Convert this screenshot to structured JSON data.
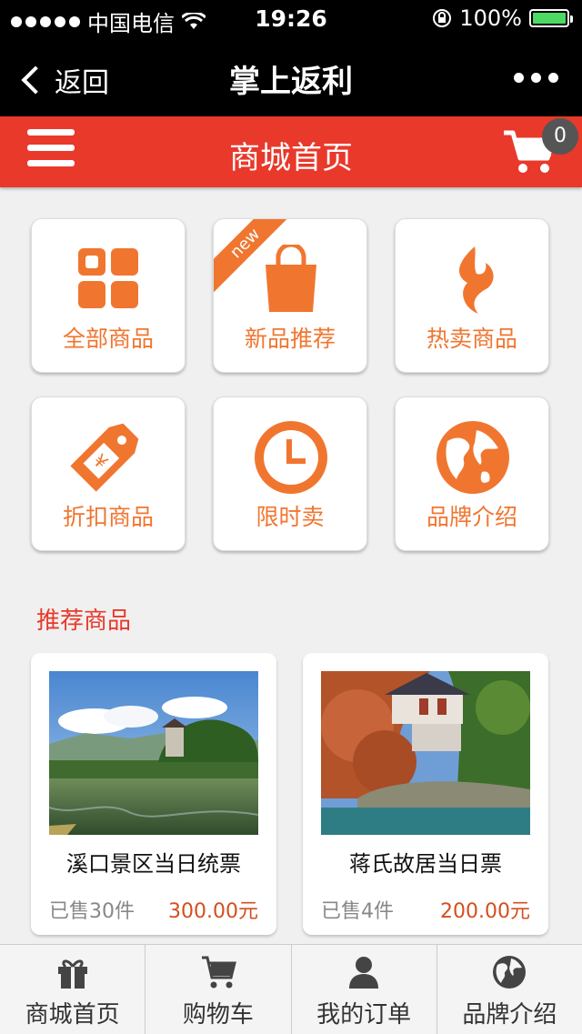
{
  "status_bar": {
    "carrier": "中国电信",
    "time": "19:26",
    "battery": "100%"
  },
  "nav": {
    "back_label": "返回",
    "title": "掌上返利"
  },
  "header": {
    "title": "商城首页",
    "cart_count": "0"
  },
  "grid": {
    "items": [
      {
        "label": "全部商品",
        "icon": "grid-icon"
      },
      {
        "label": "新品推荐",
        "icon": "shopping-bag-icon",
        "ribbon": "new"
      },
      {
        "label": "热卖商品",
        "icon": "flame-icon"
      },
      {
        "label": "折扣商品",
        "icon": "price-tag-icon"
      },
      {
        "label": "限时卖",
        "icon": "clock-icon"
      },
      {
        "label": "品牌介绍",
        "icon": "globe-icon"
      }
    ]
  },
  "recommend": {
    "title": "推荐商品",
    "products": [
      {
        "name": "溪口景区当日统票",
        "sold": "已售30件",
        "price": "300.00元"
      },
      {
        "name": "蒋氏故居当日票",
        "sold": "已售4件",
        "price": "200.00元"
      }
    ]
  },
  "tabbar": {
    "tabs": [
      {
        "label": "商城首页",
        "icon": "gift-icon"
      },
      {
        "label": "购物车",
        "icon": "cart-icon"
      },
      {
        "label": "我的订单",
        "icon": "user-icon"
      },
      {
        "label": "品牌介绍",
        "icon": "globe-icon"
      }
    ]
  },
  "colors": {
    "accent": "#e8392b",
    "icon_orange": "#f07630",
    "price": "#d2501e"
  }
}
